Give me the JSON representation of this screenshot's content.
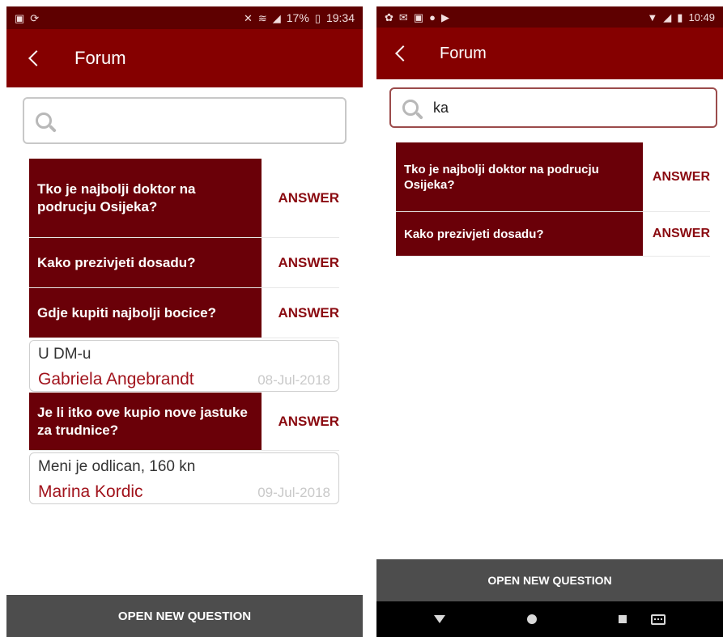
{
  "left_phone": {
    "status": {
      "left_icons": [
        "image-icon",
        "sync-icon"
      ],
      "right_icons": [
        "mute-icon",
        "wifi-icon",
        "signal-icon"
      ],
      "battery": "17%",
      "time": "19:34"
    },
    "appbar": {
      "title": "Forum"
    },
    "search": {
      "value": "",
      "placeholder": ""
    },
    "questions": [
      {
        "text": "Tko je najbolji doktor na podrucju Osijeka?",
        "answer_label": "ANSWER",
        "replies": []
      },
      {
        "text": "Kako prezivjeti dosadu?",
        "answer_label": "ANSWER",
        "replies": []
      },
      {
        "text": "Gdje kupiti najbolji bocice?",
        "answer_label": "ANSWER",
        "replies": [
          {
            "text": "U DM-u",
            "author": "Gabriela Angebrandt",
            "date": "08-Jul-2018"
          }
        ]
      },
      {
        "text": "Je li itko ove kupio nove jastuke za trudnice?",
        "answer_label": "ANSWER",
        "replies": [
          {
            "text": "Meni je odlican, 160 kn",
            "author": "Marina Kordic",
            "date": "09-Jul-2018"
          }
        ]
      }
    ],
    "bottom_button": "OPEN NEW QUESTION"
  },
  "right_phone": {
    "status": {
      "left_icons": [
        "settings-icon",
        "mail-icon",
        "gallery-icon",
        "record-icon",
        "play-store-icon"
      ],
      "right_icons": [
        "wifi-icon",
        "signal-icon",
        "battery-icon"
      ],
      "time": "10:49"
    },
    "appbar": {
      "title": "Forum"
    },
    "search": {
      "value": "ka",
      "placeholder": ""
    },
    "questions": [
      {
        "text": "Tko je najbolji doktor na podrucju Osijeka?",
        "answer_label": "ANSWER"
      },
      {
        "text": "Kako prezivjeti dosadu?",
        "answer_label": "ANSWER"
      }
    ],
    "bottom_button": "OPEN NEW QUESTION",
    "navbar": {
      "icons": [
        "back-icon",
        "home-icon",
        "recents-icon",
        "keyboard-icon"
      ]
    }
  },
  "colors": {
    "status_bar": "#5e0000",
    "app_bar": "#850000",
    "question_bg": "#6a0008",
    "answer_text": "#8a0a10",
    "author_text": "#a1131c",
    "date_text": "#c9c9c9",
    "bottom_button_bg": "#4d4d4d"
  }
}
